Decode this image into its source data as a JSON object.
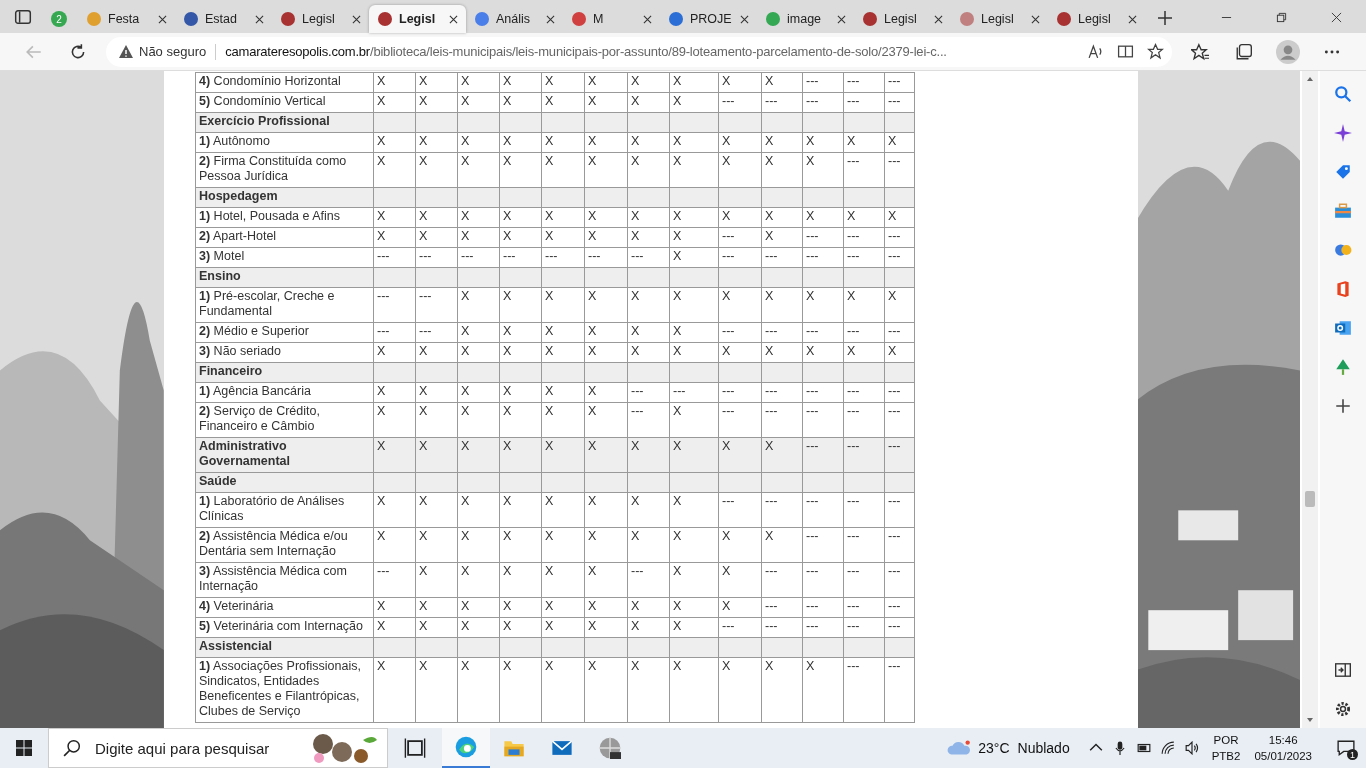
{
  "browser": {
    "tabs": [
      {
        "badge": "2",
        "selected": false
      },
      {
        "title": "Festa",
        "selected": false
      },
      {
        "title": "Estad",
        "selected": false
      },
      {
        "title": "Legisl",
        "selected": false
      },
      {
        "title": "Legisl",
        "selected": true
      },
      {
        "title": "Anális",
        "selected": false
      },
      {
        "title": "M",
        "selected": false
      },
      {
        "title": "PROJE",
        "selected": false
      },
      {
        "title": "image",
        "selected": false
      },
      {
        "title": "Legisl",
        "selected": false
      },
      {
        "title": "Legisl",
        "selected": false
      },
      {
        "title": "Legisl",
        "selected": false
      }
    ],
    "address": {
      "security": "Não seguro",
      "domain": "camarateresopolis.com.br",
      "path": "/biblioteca/leis-municipais/leis-municipais-por-assunto/89-loteamento-parcelamento-de-solo/2379-lei-c..."
    }
  },
  "table": {
    "rows": [
      {
        "kind": "item",
        "number": "4)",
        "label": "Condomínio Horizontal",
        "cells": [
          "X",
          "X",
          "X",
          "X",
          "X",
          "X",
          "X",
          "X",
          "X",
          "X",
          "---",
          "---",
          "---"
        ]
      },
      {
        "kind": "item",
        "number": "5)",
        "label": "Condomínio Vertical",
        "cells": [
          "X",
          "X",
          "X",
          "X",
          "X",
          "X",
          "X",
          "X",
          "---",
          "---",
          "---",
          "---",
          "---"
        ]
      },
      {
        "kind": "section",
        "label": "Exercício Profissional",
        "cells": []
      },
      {
        "kind": "item",
        "number": "1)",
        "label": "Autônomo",
        "cells": [
          "X",
          "X",
          "X",
          "X",
          "X",
          "X",
          "X",
          "X",
          "X",
          "X",
          "X",
          "X",
          "X"
        ]
      },
      {
        "kind": "item",
        "number": "2)",
        "label": "Firma Constituída como Pessoa Jurídica",
        "cells": [
          "X",
          "X",
          "X",
          "X",
          "X",
          "X",
          "X",
          "X",
          "X",
          "X",
          "X",
          "---",
          "---"
        ]
      },
      {
        "kind": "section",
        "label": "Hospedagem",
        "cells": []
      },
      {
        "kind": "item",
        "number": "1)",
        "label": "Hotel, Pousada e Afins",
        "cells": [
          "X",
          "X",
          "X",
          "X",
          "X",
          "X",
          "X",
          "X",
          "X",
          "X",
          "X",
          "X",
          "X"
        ]
      },
      {
        "kind": "item",
        "number": "2)",
        "label": "Apart-Hotel",
        "cells": [
          "X",
          "X",
          "X",
          "X",
          "X",
          "X",
          "X",
          "X",
          "---",
          "X",
          "---",
          "---",
          "---"
        ]
      },
      {
        "kind": "item",
        "number": "3)",
        "label": "Motel",
        "cells": [
          "---",
          "---",
          "---",
          "---",
          "---",
          "---",
          "---",
          "X",
          "---",
          "---",
          "---",
          "---",
          "---"
        ]
      },
      {
        "kind": "section",
        "label": "Ensino",
        "cells": []
      },
      {
        "kind": "item",
        "number": "1)",
        "label": "Pré-escolar, Creche e Fundamental",
        "cells": [
          "---",
          "---",
          "X",
          "X",
          "X",
          "X",
          "X",
          "X",
          "X",
          "X",
          "X",
          "X",
          "X"
        ]
      },
      {
        "kind": "item",
        "number": "2)",
        "label": "Médio e Superior",
        "cells": [
          "---",
          "---",
          "X",
          "X",
          "X",
          "X",
          "X",
          "X",
          "---",
          "---",
          "---",
          "---",
          "---"
        ]
      },
      {
        "kind": "item",
        "number": "3)",
        "label": "Não seriado",
        "cells": [
          "X",
          "X",
          "X",
          "X",
          "X",
          "X",
          "X",
          "X",
          "X",
          "X",
          "X",
          "X",
          "X"
        ]
      },
      {
        "kind": "section",
        "label": "Financeiro",
        "cells": []
      },
      {
        "kind": "item",
        "number": "1)",
        "label": "Agência Bancária",
        "cells": [
          "X",
          "X",
          "X",
          "X",
          "X",
          "X",
          "---",
          "---",
          "---",
          "---",
          "---",
          "---",
          "---"
        ]
      },
      {
        "kind": "item",
        "number": "2)",
        "label": "Serviço de Crédito, Financeiro e Câmbio",
        "cells": [
          "X",
          "X",
          "X",
          "X",
          "X",
          "X",
          "---",
          "X",
          "---",
          "---",
          "---",
          "---",
          "---"
        ]
      },
      {
        "kind": "section",
        "label": "Administrativo Governamental",
        "cells": [
          "X",
          "X",
          "X",
          "X",
          "X",
          "X",
          "X",
          "X",
          "X",
          "X",
          "---",
          "---",
          "---"
        ]
      },
      {
        "kind": "section",
        "label": "Saúde",
        "cells": []
      },
      {
        "kind": "item",
        "number": "1)",
        "label": "Laboratório de Análises Clínicas",
        "cells": [
          "X",
          "X",
          "X",
          "X",
          "X",
          "X",
          "X",
          "X",
          "---",
          "---",
          "---",
          "---",
          "---"
        ]
      },
      {
        "kind": "item",
        "number": "2)",
        "label": "Assistência Médica e/ou Dentária sem Internação",
        "cells": [
          "X",
          "X",
          "X",
          "X",
          "X",
          "X",
          "X",
          "X",
          "X",
          "X",
          "---",
          "---",
          "---"
        ]
      },
      {
        "kind": "item",
        "number": "3)",
        "label": "Assistência Médica com Internação",
        "cells": [
          "---",
          "X",
          "X",
          "X",
          "X",
          "X",
          "---",
          "X",
          "X",
          "---",
          "---",
          "---",
          "---"
        ]
      },
      {
        "kind": "item",
        "number": "4)",
        "label": "Veterinária",
        "cells": [
          "X",
          "X",
          "X",
          "X",
          "X",
          "X",
          "X",
          "X",
          "X",
          "---",
          "---",
          "---",
          "---"
        ]
      },
      {
        "kind": "item",
        "number": "5)",
        "label": "Veterinária com Internação",
        "cells": [
          "X",
          "X",
          "X",
          "X",
          "X",
          "X",
          "X",
          "X",
          "---",
          "---",
          "---",
          "---",
          "---"
        ]
      },
      {
        "kind": "section",
        "label": "Assistencial",
        "cells": []
      },
      {
        "kind": "item",
        "number": "1)",
        "label": "Associações Profissionais, Sindicatos, Entidades Beneficentes e Filantrópicas, Clubes de Serviço",
        "cells": [
          "X",
          "X",
          "X",
          "X",
          "X",
          "X",
          "X",
          "X",
          "X",
          "X",
          "X",
          "---",
          "---"
        ]
      }
    ]
  },
  "taskbar": {
    "search_placeholder": "Digite aqui para pesquisar",
    "temperature": "23°C",
    "weather": "Nublado",
    "language": "POR",
    "layout": "PTB2",
    "time": "15:46",
    "date": "05/01/2023",
    "notifications": "1"
  }
}
